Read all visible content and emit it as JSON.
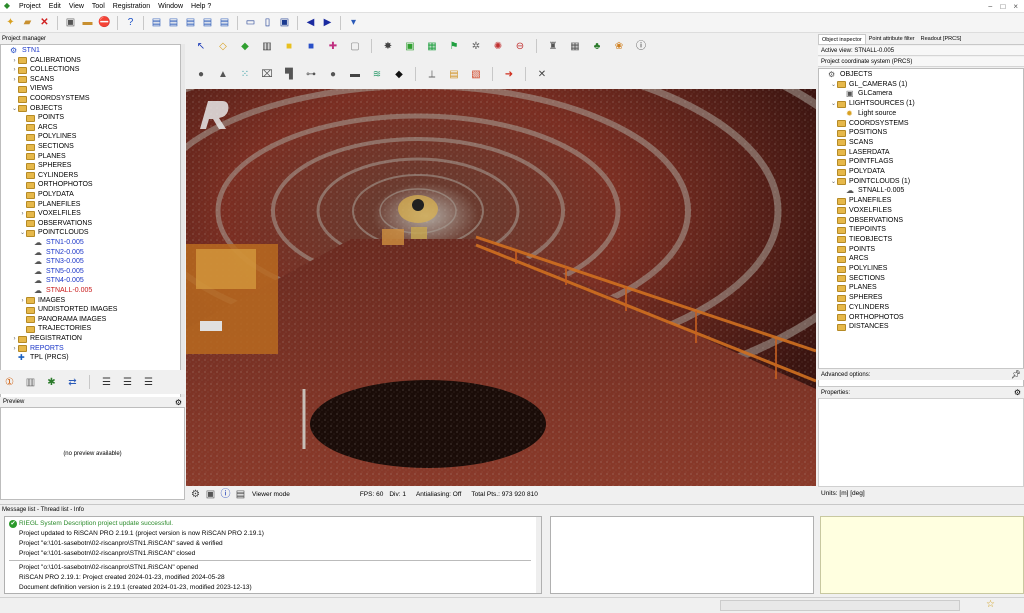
{
  "menu": [
    "Project",
    "Edit",
    "View",
    "Tool",
    "Registration",
    "Window",
    "Help ?"
  ],
  "window_controls": [
    "−",
    "□",
    "×"
  ],
  "project_manager": {
    "title": "Project manager",
    "tree": [
      {
        "label": "STN1",
        "depth": 0,
        "style": "blue",
        "icon": "scanner-icon",
        "expand": ""
      },
      {
        "label": "CALIBRATIONS",
        "depth": 1,
        "style": "",
        "icon": "folder-icon",
        "expand": "›"
      },
      {
        "label": "COLLECTIONS",
        "depth": 1,
        "style": "",
        "icon": "folder-icon",
        "expand": "›"
      },
      {
        "label": "SCANS",
        "depth": 1,
        "style": "",
        "icon": "folder-icon",
        "expand": "›"
      },
      {
        "label": "VIEWS",
        "depth": 1,
        "style": "",
        "icon": "folder-icon",
        "expand": ""
      },
      {
        "label": "COORDSYSTEMS",
        "depth": 1,
        "style": "",
        "icon": "folder-icon",
        "expand": ""
      },
      {
        "label": "OBJECTS",
        "depth": 1,
        "style": "",
        "icon": "folder-icon",
        "expand": "⌄"
      },
      {
        "label": "POINTS",
        "depth": 2,
        "style": "",
        "icon": "folder-icon",
        "expand": ""
      },
      {
        "label": "ARCS",
        "depth": 2,
        "style": "",
        "icon": "folder-icon",
        "expand": ""
      },
      {
        "label": "POLYLINES",
        "depth": 2,
        "style": "",
        "icon": "folder-icon",
        "expand": ""
      },
      {
        "label": "SECTIONS",
        "depth": 2,
        "style": "",
        "icon": "folder-icon",
        "expand": ""
      },
      {
        "label": "PLANES",
        "depth": 2,
        "style": "",
        "icon": "folder-icon",
        "expand": ""
      },
      {
        "label": "SPHERES",
        "depth": 2,
        "style": "",
        "icon": "folder-icon",
        "expand": ""
      },
      {
        "label": "CYLINDERS",
        "depth": 2,
        "style": "",
        "icon": "folder-icon",
        "expand": ""
      },
      {
        "label": "ORTHOPHOTOS",
        "depth": 2,
        "style": "",
        "icon": "folder-icon",
        "expand": ""
      },
      {
        "label": "POLYDATA",
        "depth": 2,
        "style": "",
        "icon": "folder-icon",
        "expand": ""
      },
      {
        "label": "PLANEFILES",
        "depth": 2,
        "style": "",
        "icon": "folder-icon",
        "expand": ""
      },
      {
        "label": "VOXELFILES",
        "depth": 2,
        "style": "",
        "icon": "folder-icon",
        "expand": "›"
      },
      {
        "label": "OBSERVATIONS",
        "depth": 2,
        "style": "",
        "icon": "folder-icon",
        "expand": ""
      },
      {
        "label": "POINTCLOUDS",
        "depth": 2,
        "style": "",
        "icon": "folder-icon",
        "expand": "⌄"
      },
      {
        "label": "STN1-0.005",
        "depth": 3,
        "style": "blue",
        "icon": "pointcloud-icon",
        "expand": ""
      },
      {
        "label": "STN2-0.005",
        "depth": 3,
        "style": "blue",
        "icon": "pointcloud-icon",
        "expand": ""
      },
      {
        "label": "STN3-0.005",
        "depth": 3,
        "style": "blue",
        "icon": "pointcloud-icon",
        "expand": ""
      },
      {
        "label": "STN5-0.005",
        "depth": 3,
        "style": "blue",
        "icon": "pointcloud-icon",
        "expand": ""
      },
      {
        "label": "STN4-0.005",
        "depth": 3,
        "style": "blue",
        "icon": "pointcloud-icon",
        "expand": ""
      },
      {
        "label": "STNALL-0.005",
        "depth": 3,
        "style": "red",
        "icon": "pointcloud-icon",
        "expand": ""
      },
      {
        "label": "IMAGES",
        "depth": 2,
        "style": "",
        "icon": "folder-icon",
        "expand": "›"
      },
      {
        "label": "UNDISTORTED IMAGES",
        "depth": 2,
        "style": "",
        "icon": "folder-icon",
        "expand": ""
      },
      {
        "label": "PANORAMA IMAGES",
        "depth": 2,
        "style": "",
        "icon": "folder-icon",
        "expand": ""
      },
      {
        "label": "TRAJECTORIES",
        "depth": 2,
        "style": "",
        "icon": "folder-icon",
        "expand": ""
      },
      {
        "label": "REGISTRATION",
        "depth": 1,
        "style": "",
        "icon": "folder-icon",
        "expand": "›"
      },
      {
        "label": "REPORTS",
        "depth": 1,
        "style": "blue",
        "icon": "folder-icon",
        "expand": "›"
      },
      {
        "label": "TPL (PRCS)",
        "depth": 1,
        "style": "",
        "icon": "tpl-icon",
        "expand": ""
      }
    ]
  },
  "preview": {
    "title": "Preview",
    "empty_text": "(no preview available)"
  },
  "viewer": {
    "status": {
      "mode": "Viewer mode",
      "fps": "FPS: 60",
      "div": "Div: 1",
      "antialiasing": "Antialiasing: Off",
      "total_pts": "Total Pts.: 973 920 810"
    }
  },
  "object_inspector": {
    "tabs": [
      "Object inspector",
      "Point attribute filter",
      "Readout [PRCS]"
    ],
    "active_view": "Active view: STNALL-0.005",
    "coord_system": "Project coordinate system (PRCS)",
    "tree": [
      {
        "label": "OBJECTS",
        "depth": 0,
        "icon": "objects-icon",
        "expand": ""
      },
      {
        "label": "GL_CAMERAS (1)",
        "depth": 1,
        "icon": "folder-icon",
        "expand": "⌄"
      },
      {
        "label": "GLCamera",
        "depth": 2,
        "icon": "camera-icon",
        "expand": ""
      },
      {
        "label": "LIGHTSOURCES (1)",
        "depth": 1,
        "icon": "folder-icon",
        "expand": "⌄"
      },
      {
        "label": "Light source",
        "depth": 2,
        "icon": "light-icon",
        "expand": ""
      },
      {
        "label": "COORDSYSTEMS",
        "depth": 1,
        "icon": "folder-icon",
        "expand": ""
      },
      {
        "label": "POSITIONS",
        "depth": 1,
        "icon": "folder-icon",
        "expand": ""
      },
      {
        "label": "SCANS",
        "depth": 1,
        "icon": "folder-icon",
        "expand": ""
      },
      {
        "label": "LASERDATA",
        "depth": 1,
        "icon": "folder-icon",
        "expand": ""
      },
      {
        "label": "POINTFLAGS",
        "depth": 1,
        "icon": "folder-icon",
        "expand": ""
      },
      {
        "label": "POLYDATA",
        "depth": 1,
        "icon": "folder-icon",
        "expand": ""
      },
      {
        "label": "POINTCLOUDS (1)",
        "depth": 1,
        "icon": "folder-icon",
        "expand": "⌄"
      },
      {
        "label": "STNALL-0.005",
        "depth": 2,
        "icon": "pointcloud-icon",
        "expand": ""
      },
      {
        "label": "PLANEFILES",
        "depth": 1,
        "icon": "folder-icon",
        "expand": ""
      },
      {
        "label": "VOXELFILES",
        "depth": 1,
        "icon": "folder-icon",
        "expand": ""
      },
      {
        "label": "OBSERVATIONS",
        "depth": 1,
        "icon": "folder-icon",
        "expand": ""
      },
      {
        "label": "TIEPOINTS",
        "depth": 1,
        "icon": "folder-icon",
        "expand": ""
      },
      {
        "label": "TIEOBJECTS",
        "depth": 1,
        "icon": "folder-icon",
        "expand": ""
      },
      {
        "label": "POINTS",
        "depth": 1,
        "icon": "folder-icon",
        "expand": ""
      },
      {
        "label": "ARCS",
        "depth": 1,
        "icon": "folder-icon",
        "expand": ""
      },
      {
        "label": "POLYLINES",
        "depth": 1,
        "icon": "folder-icon",
        "expand": ""
      },
      {
        "label": "SECTIONS",
        "depth": 1,
        "icon": "folder-icon",
        "expand": ""
      },
      {
        "label": "PLANES",
        "depth": 1,
        "icon": "folder-icon",
        "expand": ""
      },
      {
        "label": "SPHERES",
        "depth": 1,
        "icon": "folder-icon",
        "expand": ""
      },
      {
        "label": "CYLINDERS",
        "depth": 1,
        "icon": "folder-icon",
        "expand": ""
      },
      {
        "label": "ORTHOPHOTOS",
        "depth": 1,
        "icon": "folder-icon",
        "expand": ""
      },
      {
        "label": "DISTANCES",
        "depth": 1,
        "icon": "folder-icon",
        "expand": ""
      }
    ],
    "advanced_options": "Advanced options:",
    "properties": "Properties:",
    "units": "Units: [m] [deg]"
  },
  "message_area": {
    "title": "Message list - Thread list - Info",
    "messages": [
      {
        "text": "RIEGL System Description project update successful.",
        "kind": "ok"
      },
      {
        "text": "Project updated to RiSCAN PRO 2.19.1 (project version is now RiSCAN PRO 2.19.1)",
        "kind": ""
      },
      {
        "text": "Project \"e:\\101-sasebotn\\02-riscanpro\\STN1.RiSCAN\" saved & verified",
        "kind": ""
      },
      {
        "text": "Project \"e:\\101-sasebotn\\02-riscanpro\\STN1.RiSCAN\" closed",
        "kind": ""
      },
      {
        "text": "Project \"o:\\101-sasebotn\\02-riscanpro\\STN1.RiSCAN\" opened",
        "kind": ""
      },
      {
        "text": "RiSCAN PRO 2.19.1: Project created 2024-01-23, modified 2024-05-28",
        "kind": ""
      },
      {
        "text": "Document definition version is 2.19.1 (created 2024-01-23, modified 2023-12-13)",
        "kind": ""
      }
    ]
  },
  "colors": {
    "tree_blue": "#1a35c8",
    "tree_red": "#c81a1a",
    "success_green": "#2a8a2a",
    "pointcloud_red": "#8b2a1c"
  }
}
